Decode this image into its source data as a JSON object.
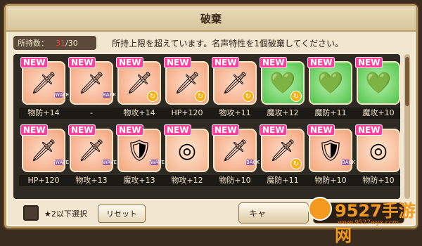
{
  "dialog": {
    "title": "破棄"
  },
  "info": {
    "count_label": "所持数：",
    "count_current": "31",
    "count_max": "/30",
    "notice": "所持上限を超えています。名声特性を1個破棄してください。"
  },
  "cards": [
    {
      "new": "NEW",
      "theme": "pink",
      "icon": "sword-icon",
      "tag": "WAVE",
      "sync": false,
      "stat": "物防+14"
    },
    {
      "new": "NEW",
      "theme": "pink",
      "icon": "sword-icon",
      "tag": "BACK",
      "sync": false,
      "stat": "-"
    },
    {
      "new": "NEW",
      "theme": "pink",
      "icon": "sword-icon",
      "tag": "",
      "sync": true,
      "stat": "物攻+14"
    },
    {
      "new": "NEW",
      "theme": "pink",
      "icon": "sword-icon",
      "tag": "",
      "sync": true,
      "stat": "HP+120"
    },
    {
      "new": "NEW",
      "theme": "pink",
      "icon": "sword-icon",
      "tag": "",
      "sync": true,
      "stat": "物攻+11"
    },
    {
      "new": "NEW",
      "theme": "green",
      "icon": "heart-icon",
      "tag": "",
      "sync": true,
      "stat": "魔攻+12"
    },
    {
      "new": "NEW",
      "theme": "green",
      "icon": "heart-icon",
      "tag": "",
      "sync": false,
      "stat": "魔防+11"
    },
    {
      "new": "NEW",
      "theme": "green",
      "icon": "heart-icon",
      "tag": "",
      "sync": false,
      "stat": "魔攻+10"
    },
    {
      "new": "NEW",
      "theme": "pink",
      "icon": "sword-icon",
      "tag": "WAVE",
      "sync": false,
      "stat": "HP+120"
    },
    {
      "new": "NEW",
      "theme": "pink",
      "icon": "sword-icon",
      "tag": "WAVE",
      "sync": false,
      "stat": "物攻+13"
    },
    {
      "new": "NEW",
      "theme": "pink",
      "icon": "shield-icon",
      "tag": "WAVE",
      "sync": false,
      "stat": "魔攻+13"
    },
    {
      "new": "NEW",
      "theme": "peach",
      "icon": "target-icon",
      "tag": "",
      "sync": false,
      "stat": "物攻+12"
    },
    {
      "new": "NEW",
      "theme": "pink",
      "icon": "sword-icon",
      "tag": "BACK",
      "sync": false,
      "stat": "物防+10"
    },
    {
      "new": "NEW",
      "theme": "pink",
      "icon": "sword-icon",
      "tag": "",
      "sync": true,
      "stat": "魔防+11"
    },
    {
      "new": "NEW",
      "theme": "pink",
      "icon": "shield-icon",
      "tag": "BACK",
      "sync": false,
      "stat": "物防+10"
    },
    {
      "new": "NEW",
      "theme": "peach",
      "icon": "target-icon",
      "tag": "",
      "sync": false,
      "stat": "物防+10"
    }
  ],
  "footer": {
    "filter_label": "★2以下選択",
    "reset_label": "リセット",
    "cancel_label": "キャ"
  },
  "watermark": {
    "brand": "9527手游网",
    "url": "www.9527wyx.com"
  }
}
